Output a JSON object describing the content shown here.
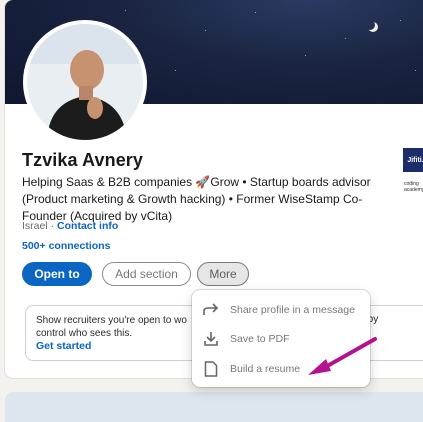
{
  "profile": {
    "name": "Tzvika Avnery",
    "headline": "Helping Saas & B2B companies 🚀Grow • Startup boards advisor (Product marketing & Growth hacking) • Former WiseStamp Co-Founder (Acquired by vCita)",
    "location": "Israel",
    "location_separator": " · ",
    "contact_info": "Contact info",
    "connections": "500+ connections"
  },
  "actions": {
    "open_to": "Open to",
    "add_section": "Add section",
    "more": "More"
  },
  "recruiter_panel": {
    "text_left": "Show recruiters you're open to wo control who sees this.",
    "text_right": "al clients by",
    "link": "Get started"
  },
  "companies": [
    {
      "label": "Jifiti."
    },
    {
      "label": "coding academy"
    }
  ],
  "more_menu": {
    "items": [
      {
        "label": "Share profile in a message",
        "icon": "share-arrow-icon"
      },
      {
        "label": "Save to PDF",
        "icon": "download-icon"
      },
      {
        "label": "Build a resume",
        "icon": "document-icon"
      }
    ]
  },
  "colors": {
    "accent": "#0a66c2",
    "annotation_arrow": "#b5128f"
  }
}
